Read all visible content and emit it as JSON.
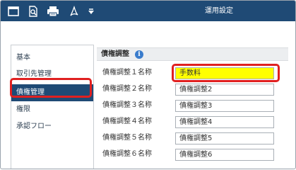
{
  "toolbar": {
    "title": "運用設定",
    "buttons": [
      {
        "icon": "window-icon"
      },
      {
        "icon": "search-document-icon"
      },
      {
        "icon": "print-icon"
      },
      {
        "icon": "pdf-icon"
      },
      {
        "icon": "dropdown-arrow-icon"
      }
    ]
  },
  "sidebar": {
    "items": [
      {
        "label": "基本"
      },
      {
        "label": "取引先管理"
      },
      {
        "label": "債権管理",
        "selected": true
      },
      {
        "label": "権限"
      },
      {
        "label": "承認フロー"
      }
    ]
  },
  "panel": {
    "title": "債権調整",
    "rows": [
      {
        "label": "債権調整１名称",
        "value": "手数料"
      },
      {
        "label": "債権調整２名称",
        "value": "債権調整2"
      },
      {
        "label": "債権調整３名称",
        "value": "債権調整3"
      },
      {
        "label": "債権調整４名称",
        "value": "債権調整4"
      },
      {
        "label": "債権調整５名称",
        "value": "債権調整5"
      },
      {
        "label": "債権調整６名称",
        "value": "債権調整6"
      }
    ]
  },
  "colors": {
    "toolbar": "#1f4a75",
    "selected_item": "#1f4a75",
    "highlight_field": "#ffff00",
    "callout_ring": "#e02020",
    "info_icon": "#3a7ccc"
  }
}
